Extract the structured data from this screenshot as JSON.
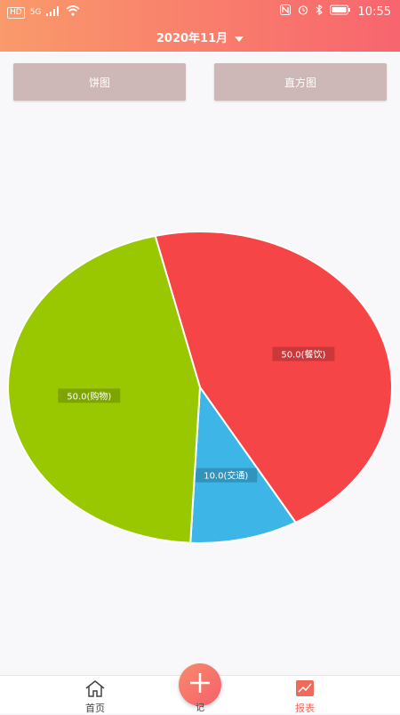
{
  "status": {
    "signal": "HD",
    "net": "5G",
    "time": "10:55"
  },
  "header": {
    "title": "2020年11月"
  },
  "toggles": {
    "pie": "饼图",
    "histogram": "直方图"
  },
  "chart_data": {
    "type": "pie",
    "slices": [
      {
        "label": "50.0(餐饮)",
        "value": 50.0,
        "color": "#f64547"
      },
      {
        "label": "10.0(交通)",
        "value": 10.0,
        "color": "#3db5e6"
      },
      {
        "label": "50.0(购物)",
        "value": 50.0,
        "color": "#9ac800"
      }
    ],
    "start_angle_deg": -103.5
  },
  "nav": {
    "home": "首页",
    "add": "记",
    "report": "报表"
  },
  "colors": {
    "active_tab": "#f0695b",
    "toggle_bg": "#cdb8b7"
  }
}
